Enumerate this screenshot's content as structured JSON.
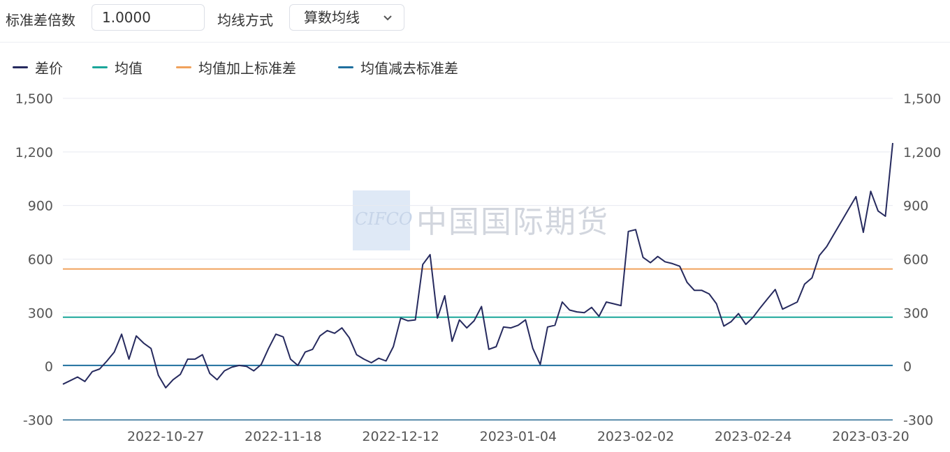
{
  "controls": {
    "std_label": "标准差倍数",
    "std_value": "1.0000",
    "ma_label": "均线方式",
    "ma_selected": "算数均线"
  },
  "watermark": {
    "logo": "CIFCO",
    "text": "中国国际期货"
  },
  "colors": {
    "spread": "#262a5e",
    "mean": "#1aa69a",
    "upper": "#f0a25c",
    "lower": "#1f6f9e",
    "grid": "#e8eaf0"
  },
  "chart_data": {
    "type": "line",
    "legend": [
      "差价",
      "均值",
      "均值加上标准差",
      "均值减去标准差"
    ],
    "ylim": [
      -300,
      1500
    ],
    "yticks": [
      "1,500",
      "1,200",
      "900",
      "600",
      "300",
      "0",
      "-300"
    ],
    "yticks_values": [
      1500,
      1200,
      900,
      600,
      300,
      0,
      -300
    ],
    "xtick_labels": [
      "2022-10-27",
      "2022-11-18",
      "2022-12-12",
      "2023-01-04",
      "2023-02-02",
      "2023-02-24",
      "2023-03-20"
    ],
    "xtick_index": [
      14,
      30,
      46,
      62,
      78,
      94,
      110
    ],
    "grid": true,
    "legend_position": "top-left",
    "series": [
      {
        "name": "差价",
        "values": [
          -100,
          -80,
          -60,
          -85,
          -30,
          -15,
          30,
          80,
          180,
          40,
          170,
          130,
          100,
          -50,
          -120,
          -75,
          -45,
          40,
          40,
          65,
          -40,
          -75,
          -25,
          -5,
          5,
          0,
          -25,
          10,
          100,
          180,
          165,
          40,
          5,
          80,
          95,
          170,
          200,
          185,
          215,
          160,
          65,
          40,
          20,
          45,
          30,
          110,
          270,
          255,
          260,
          570,
          625,
          270,
          395,
          140,
          260,
          215,
          255,
          335,
          95,
          110,
          220,
          215,
          230,
          260,
          100,
          10,
          220,
          230,
          360,
          315,
          305,
          300,
          330,
          280,
          360,
          350,
          340,
          755,
          765,
          610,
          580,
          615,
          585,
          575,
          560,
          470,
          425,
          425,
          405,
          350,
          225,
          250,
          295,
          235,
          275,
          330,
          380,
          430,
          320,
          340,
          360,
          460,
          495,
          620,
          670,
          740,
          810,
          880,
          950,
          750,
          980,
          870,
          840,
          1250
        ],
        "x": "daily index 0-111"
      },
      {
        "name": "均值",
        "values": [
          275
        ]
      },
      {
        "name": "均值加上标准差",
        "values": [
          545
        ]
      },
      {
        "name": "均值减去标准差",
        "values": [
          5
        ]
      }
    ]
  }
}
